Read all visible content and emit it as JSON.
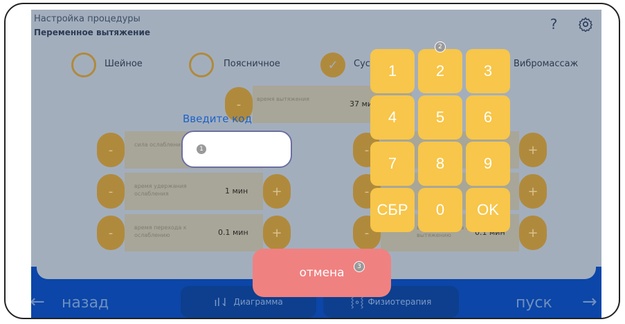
{
  "header": {
    "title": "Настройка процедуры",
    "subtitle": "Переменное вытяжение",
    "help_icon": "question-icon",
    "settings_icon": "gear-icon"
  },
  "modes": [
    {
      "label": "Шейное",
      "checked": false
    },
    {
      "label": "Поясничное",
      "checked": false
    },
    {
      "label": "Суст",
      "checked": true
    },
    {
      "label": "Вибромассаж",
      "checked": false
    }
  ],
  "params": {
    "stretch_time": {
      "label": "время вытяжения",
      "value": "37 ми"
    },
    "weakening_force": {
      "label": "сила ослабления"
    },
    "hold_weakening": {
      "label": "время удержания ослабления",
      "value": "1 мин"
    },
    "transition_weakening": {
      "label": "время перехода к ослаблению",
      "value": "0.1 мин"
    },
    "transition_stretch": {
      "label": "время перехода к вытяжению",
      "value": "0.1 мин"
    },
    "minus": "-",
    "plus": "+"
  },
  "dialog": {
    "title": "Введите код",
    "code_value": "",
    "badges": [
      "1",
      "2",
      "3"
    ]
  },
  "keypad": {
    "keys": [
      "1",
      "2",
      "3",
      "4",
      "5",
      "6",
      "7",
      "8",
      "9",
      "СБР",
      "0",
      "OK"
    ]
  },
  "cancel_label": "отмена",
  "footer": {
    "back_label": "назад",
    "diagram_label": "Диаграмма",
    "physio_label": "Физиотерапия",
    "start_label": "пуск"
  },
  "colors": {
    "key_bg": "#f7c64a",
    "cancel_bg": "#f08181",
    "accent_text": "#1d63c4",
    "bottom_bar": "#0b46a8"
  }
}
